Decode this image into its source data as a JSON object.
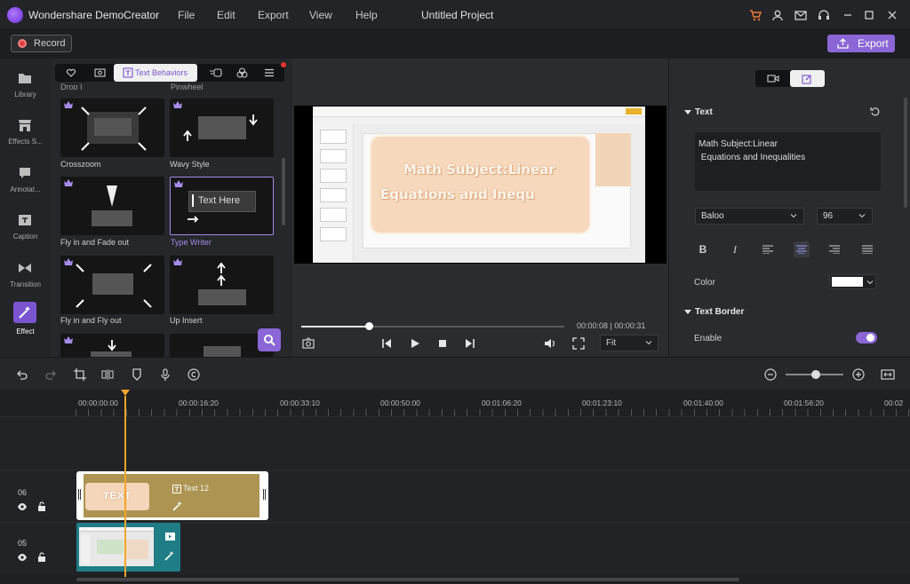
{
  "app": {
    "title": "Wondershare DemoCreator",
    "project_title": "Untitled Project",
    "menu": [
      "File",
      "Edit",
      "Export",
      "View",
      "Help"
    ]
  },
  "toolbar": {
    "record_label": "Record",
    "export_label": "Export"
  },
  "left_rail": [
    {
      "label": "Library",
      "icon": "folder-icon"
    },
    {
      "label": "Effects S...",
      "icon": "store-icon"
    },
    {
      "label": "Annotat...",
      "icon": "speech-bubble-icon"
    },
    {
      "label": "Caption",
      "icon": "caption-icon"
    },
    {
      "label": "Transition",
      "icon": "bowtie-icon"
    },
    {
      "label": "Effect",
      "icon": "magic-wand-icon",
      "active": true
    }
  ],
  "effects_panel": {
    "active_tab": "Text Behaviors",
    "partial_labels": [
      "Drop I",
      "Pinwheel"
    ],
    "items": [
      {
        "label": "Crosszoom"
      },
      {
        "label": "Wavy Style"
      },
      {
        "label": "Fly in and Fade out"
      },
      {
        "label": "Type Writer",
        "selected": true,
        "thumb_text": "Text Here"
      },
      {
        "label": "Fly in and Fly out"
      },
      {
        "label": "Up Insert"
      }
    ]
  },
  "preview": {
    "card_line1": "Math Subject:Linear",
    "card_line2": "Equations and Inequ",
    "time": "00:00:08 | 00:00:31",
    "progress": 0.26,
    "fit": "Fit"
  },
  "properties": {
    "text_section": "Text",
    "text_value": "Math Subject:Linear\n Equations and Inequalities",
    "font": "Baloo",
    "size": "96",
    "color_label": "Color",
    "color_value": "#ffffff",
    "border_section": "Text Border",
    "enable_label": "Enable",
    "enable_on": true
  },
  "timeline": {
    "ticks": [
      "00:00:00:00",
      "00:00:16:20",
      "00:00:33:10",
      "00:00:50:00",
      "00:01:06:20",
      "00:01:23:10",
      "00:01:40:00",
      "00:01:56:20",
      "00:02"
    ],
    "tracks": [
      {
        "num": "06",
        "clip_label": "Text 12",
        "thumb_text": "TEXT"
      },
      {
        "num": "05"
      }
    ]
  },
  "colors": {
    "accent": "#8a66d6",
    "playhead": "#f2a62a",
    "text_clip": "#ad9452",
    "media_clip": "#1f7d86"
  }
}
